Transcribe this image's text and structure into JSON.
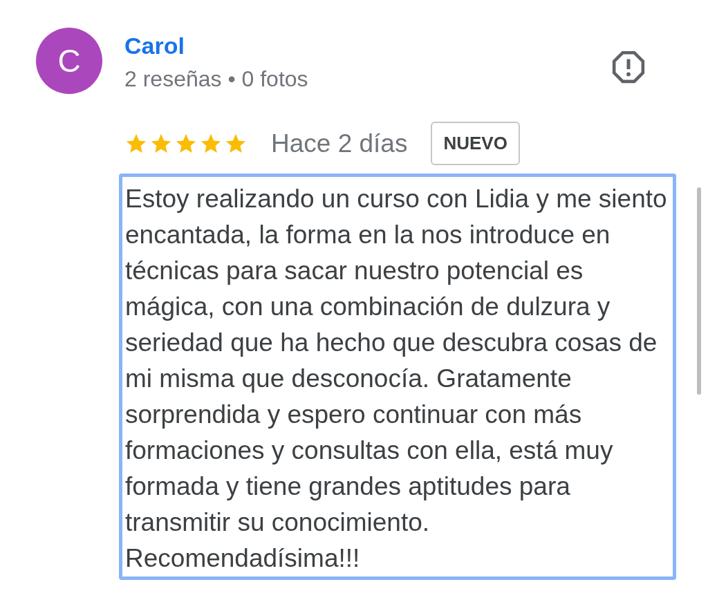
{
  "review": {
    "avatar_letter": "C",
    "author": "Carol",
    "meta": "2 reseñas • 0 fotos",
    "stars": 5,
    "time": "Hace 2 días",
    "badge": "NUEVO",
    "text": "Estoy realizando un curso con Lidia y me siento encantada, la forma en la nos introduce en técnicas para sacar nuestro potencial es mágica, con una combinación de dulzura y seriedad que ha hecho que descubra cosas de mi misma que desconocía. Gratamente sorprendida y espero continuar con más formaciones y consultas con ella, está muy formada y tiene grandes aptitudes para transmitir su conocimiento.\nRecomendadísima!!!"
  }
}
